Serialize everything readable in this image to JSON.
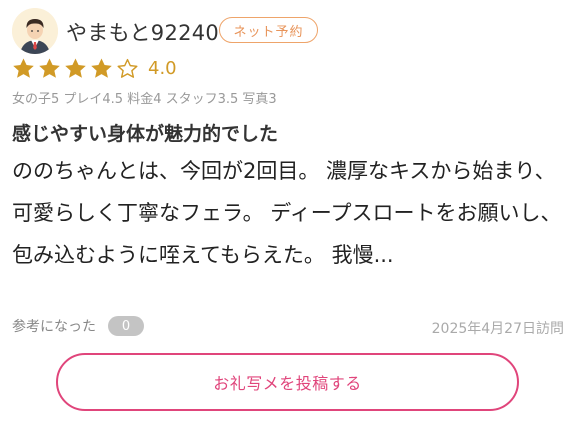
{
  "review": {
    "username": "やまもと92240",
    "badge": "ネット予約",
    "rating": "4.0",
    "stars_filled": 4,
    "stars_total": 5,
    "subscores": "女の子5 プレイ4.5 料金4 スタッフ3.5 写真3",
    "title": "感じやすい身体が魅力的でした",
    "body": "ののちゃんとは、今回が2回目。 濃厚なキスから始まり、可愛らしく丁寧なフェラ。 ディープスロートをお願いし、包み込むように咥えてもらえた。 我慢...",
    "helpful_label": "参考になった",
    "helpful_count": "0",
    "visit_date": "2025年4月27日訪問"
  },
  "actions": {
    "post_photo_label": "お礼写メを投稿する"
  },
  "colors": {
    "accent_pink": "#e0457b",
    "badge_orange": "#eea46a",
    "star_gold": "#d19a26"
  },
  "icons": {
    "avatar": "user-avatar-icon",
    "star_filled": "star-filled-icon",
    "star_empty": "star-empty-icon"
  }
}
